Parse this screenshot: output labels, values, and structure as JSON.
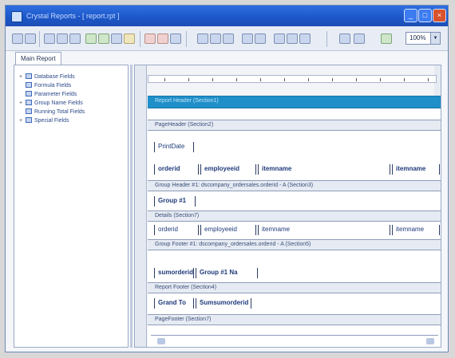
{
  "window": {
    "title": "Crystal Reports - [ report.rpt ]",
    "accent": "#1b56c7"
  },
  "toolbar": {
    "zoom_value": "100%",
    "icons": [
      "select-icon",
      "insert-field-icon",
      "sort-icon",
      "format-icon",
      "chart-icon",
      "line-icon",
      "box-icon",
      "page-setup-icon",
      "print-icon",
      "export-icon"
    ]
  },
  "tabs": {
    "main_report": "Main Report"
  },
  "field_explorer": {
    "items": [
      {
        "expander": "+",
        "label": "Database Fields"
      },
      {
        "expander": "",
        "label": "Formula Fields"
      },
      {
        "expander": "",
        "label": "Parameter Fields"
      },
      {
        "expander": "+",
        "label": "Group Name Fields"
      },
      {
        "expander": "",
        "label": "Running Total Fields"
      },
      {
        "expander": "+",
        "label": "Special Fields"
      }
    ]
  },
  "design": {
    "sections": {
      "report_header": "Report Header (Section1)",
      "page_header": "PageHeader (Section2)",
      "group_header": "Group Header #1: dscompany_ordersales.orderid - A (Section3)",
      "details": "Details (Section7)",
      "group_footer": "Group Footer #1: dscompany_ordersales.orderid - A (Section5)",
      "report_footer": "Report Footer (Section4)",
      "page_footer": "PageFooter (Section7)"
    },
    "fields": {
      "print_date": "PrintDate",
      "ph_orderid": "orderid",
      "ph_employeeid": "employeeid",
      "ph_itemname": "itemname",
      "ph_itemname_right": "itemname",
      "group_name": "Group #1",
      "d_orderid": "orderid",
      "d_employeeid": "employeeid",
      "d_itemname": "itemname",
      "d_itemname_right": "itemname",
      "gf_sum": "sumorderid",
      "gf_group_name": "Group #1 Na",
      "rf_grand_total": "Grand To",
      "rf_sum": "Sumsumorderid"
    }
  }
}
